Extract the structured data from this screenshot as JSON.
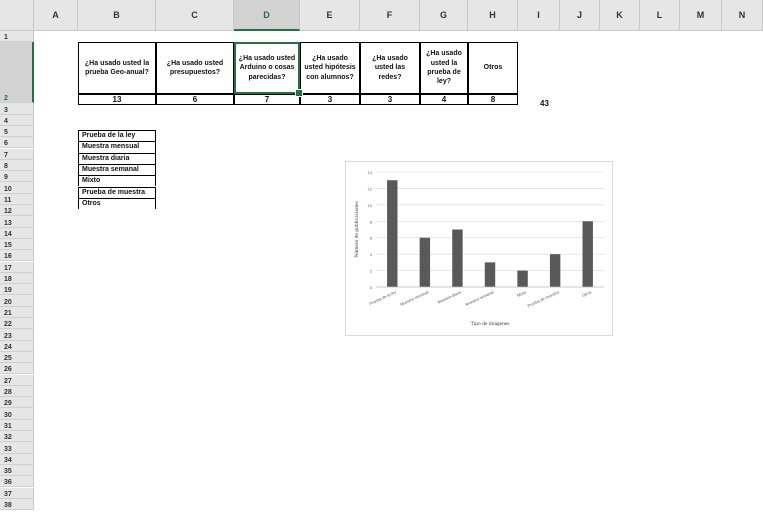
{
  "sheet": {
    "column_headers": [
      "A",
      "B",
      "C",
      "D",
      "E",
      "F",
      "G",
      "H",
      "I",
      "J",
      "K",
      "L",
      "M",
      "N"
    ],
    "row_headers": [
      "1",
      "2",
      "3",
      "4",
      "5",
      "6",
      "7",
      "8",
      "9",
      "10",
      "11",
      "12",
      "13",
      "14",
      "15",
      "16",
      "17",
      "18",
      "19",
      "20",
      "21",
      "22",
      "23",
      "24",
      "25",
      "26",
      "27",
      "28",
      "29",
      "30",
      "31",
      "32",
      "33",
      "34",
      "35",
      "36",
      "37",
      "38"
    ],
    "selected_column": "D",
    "selected_row": "2"
  },
  "questions": [
    {
      "text": "¿Ha usado usted la prueba Geo-anual?",
      "value": "13"
    },
    {
      "text": "¿Ha usado usted presupuestos?",
      "value": "6"
    },
    {
      "text": "¿Ha usado usted Arduino o cosas parecidas?",
      "value": "7"
    },
    {
      "text": "¿Ha usado usted hipótesis con alumnos?",
      "value": "3"
    },
    {
      "text": "¿Ha usado usted las redes?",
      "value": "3"
    },
    {
      "text": "¿Ha usado usted la prueba de ley?",
      "value": "4"
    },
    {
      "text": "Otros",
      "value": "8"
    }
  ],
  "total": "43",
  "legend_list": [
    "Prueba de la ley",
    "Muestra mensual",
    "Muestra diaria",
    "Muestra semanal",
    "Mixto",
    "Prueba de muestra",
    "Otros"
  ],
  "chart_data": {
    "type": "bar",
    "categories": [
      "Prueba de la ley",
      "Muestra mensual",
      "Muestra diaria",
      "Muestra semanal",
      "Mixto",
      "Prueba de muestra",
      "Otros"
    ],
    "values": [
      13,
      6,
      7,
      3,
      2,
      4,
      8
    ],
    "ylabel": "Número de publicaciones",
    "xlabel": "Tipo de imágenes",
    "ylim": [
      0,
      14
    ],
    "yticks": [
      "0",
      "2",
      "4",
      "6",
      "8",
      "10",
      "12",
      "14"
    ],
    "grid": true,
    "bar_color": "#595959"
  }
}
